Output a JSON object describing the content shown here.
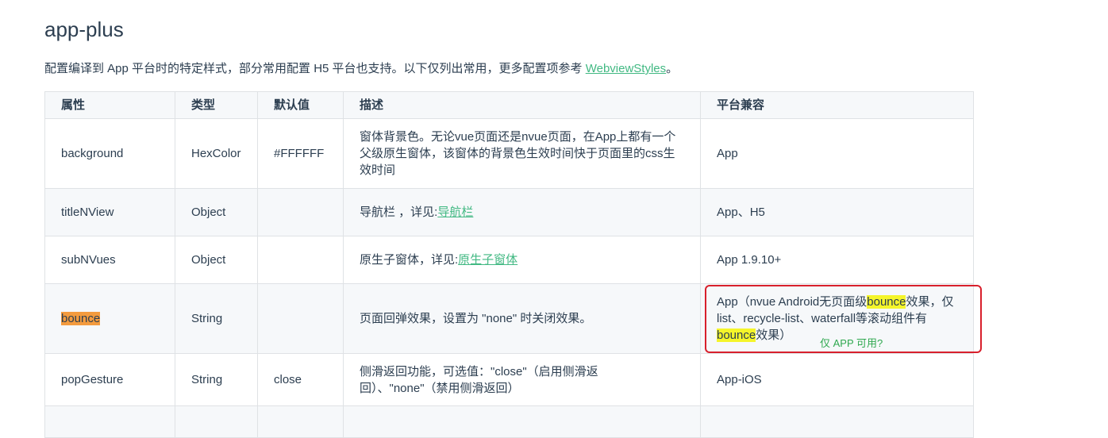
{
  "section_title": "app-plus",
  "intro": {
    "text": "配置编译到 App 平台时的特定样式，部分常用配置 H5 平台也支持。以下仅列出常用，更多配置项参考 ",
    "link": "WebviewStyles",
    "suffix": "。"
  },
  "table": {
    "headers": [
      "属性",
      "类型",
      "默认值",
      "描述",
      "平台兼容"
    ],
    "rows": [
      {
        "prop": "background",
        "type": "HexColor",
        "default": "#FFFFFF",
        "desc": "窗体背景色。无论vue页面还是nvue页面，在App上都有一个父级原生窗体，该窗体的背景色生效时间快于页面里的css生效时间",
        "platform": "App"
      },
      {
        "prop": "titleNView",
        "type": "Object",
        "default": "",
        "desc": "导航栏 ，详见:",
        "desc_link": "导航栏",
        "platform": "App、H5"
      },
      {
        "prop": "subNVues",
        "type": "Object",
        "default": "",
        "desc": "原生子窗体，详见:",
        "desc_link": "原生子窗体",
        "platform": "App 1.9.10+"
      },
      {
        "prop": "bounce",
        "type": "String",
        "default": "",
        "desc": "页面回弹效果，设置为 \"none\" 时关闭效果。",
        "platform_parts": [
          "App（nvue Android无页面级",
          "bounce",
          "效果，仅list、recycle-list、waterfall等滚动组件有",
          "bounce",
          "效果）"
        ]
      },
      {
        "prop": "popGesture",
        "type": "String",
        "default": "close",
        "desc": "侧滑返回功能，可选值：\"close\"（启用侧滑返回）、\"none\"（禁用侧滑返回）",
        "platform": "App-iOS"
      }
    ]
  },
  "annotation": {
    "note": "仅 APP 可用?",
    "border_color": "#d8202c",
    "text_color": "#2fa84f"
  },
  "colors": {
    "link": "#42b983",
    "highlight_orange": "#f39b3e",
    "highlight_yellow": "#f5f52a"
  }
}
